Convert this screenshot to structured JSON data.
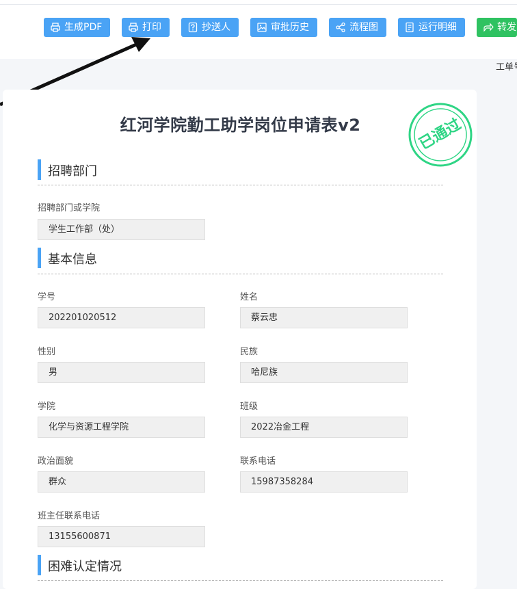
{
  "toolbar": {
    "buttons": [
      {
        "label": "生成PDF",
        "icon": "printer-icon"
      },
      {
        "label": "打印",
        "icon": "printer-icon"
      },
      {
        "label": "抄送人",
        "icon": "question-icon"
      },
      {
        "label": "审批历史",
        "icon": "image-icon"
      },
      {
        "label": "流程图",
        "icon": "share-icon"
      },
      {
        "label": "运行明细",
        "icon": "document-icon"
      },
      {
        "label": "转发",
        "icon": "forward-icon"
      }
    ],
    "ticket_label": "工单号"
  },
  "colors": {
    "primary": "#4aa3f5",
    "forward": "#2fc261",
    "stamp": "#2fd585"
  },
  "form": {
    "title": "红河学院勤工助学岗位申请表v2",
    "stamp": "已通过",
    "sections": [
      {
        "title": "招聘部门"
      },
      {
        "title": "基本信息"
      },
      {
        "title": "困难认定情况"
      }
    ],
    "fields": {
      "department": {
        "label": "招聘部门或学院",
        "value": "学生工作部（处）"
      },
      "student_id": {
        "label": "学号",
        "value": "202201020512"
      },
      "name": {
        "label": "姓名",
        "value": "蔡云忠"
      },
      "gender": {
        "label": "性别",
        "value": "男"
      },
      "ethnicity": {
        "label": "民族",
        "value": "哈尼族"
      },
      "college": {
        "label": "学院",
        "value": "化学与资源工程学院"
      },
      "class": {
        "label": "班级",
        "value": "2022冶金工程"
      },
      "political": {
        "label": "政治面貌",
        "value": "群众"
      },
      "phone": {
        "label": "联系电话",
        "value": "15987358284"
      },
      "teacher_phone": {
        "label": "班主任联系电话",
        "value": "13155600871"
      }
    }
  }
}
